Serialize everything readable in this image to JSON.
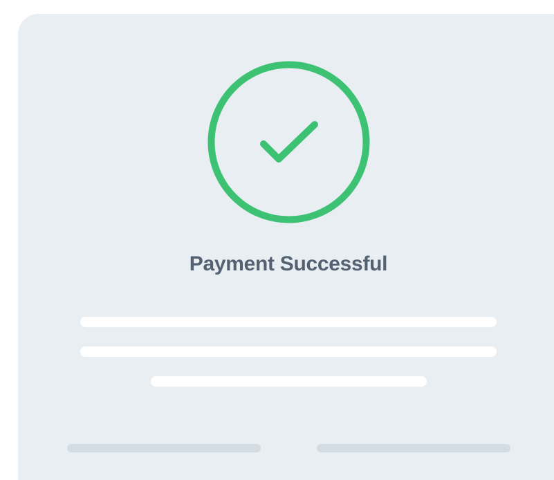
{
  "dialog": {
    "title": "Payment Successful",
    "status_icon": "check-circle-icon",
    "accent_color": "#3dc273"
  },
  "colors": {
    "card_background": "#e9eef3",
    "title_text": "#536170",
    "placeholder_line": "#ffffff",
    "footer_placeholder": "#d3dbe3"
  }
}
